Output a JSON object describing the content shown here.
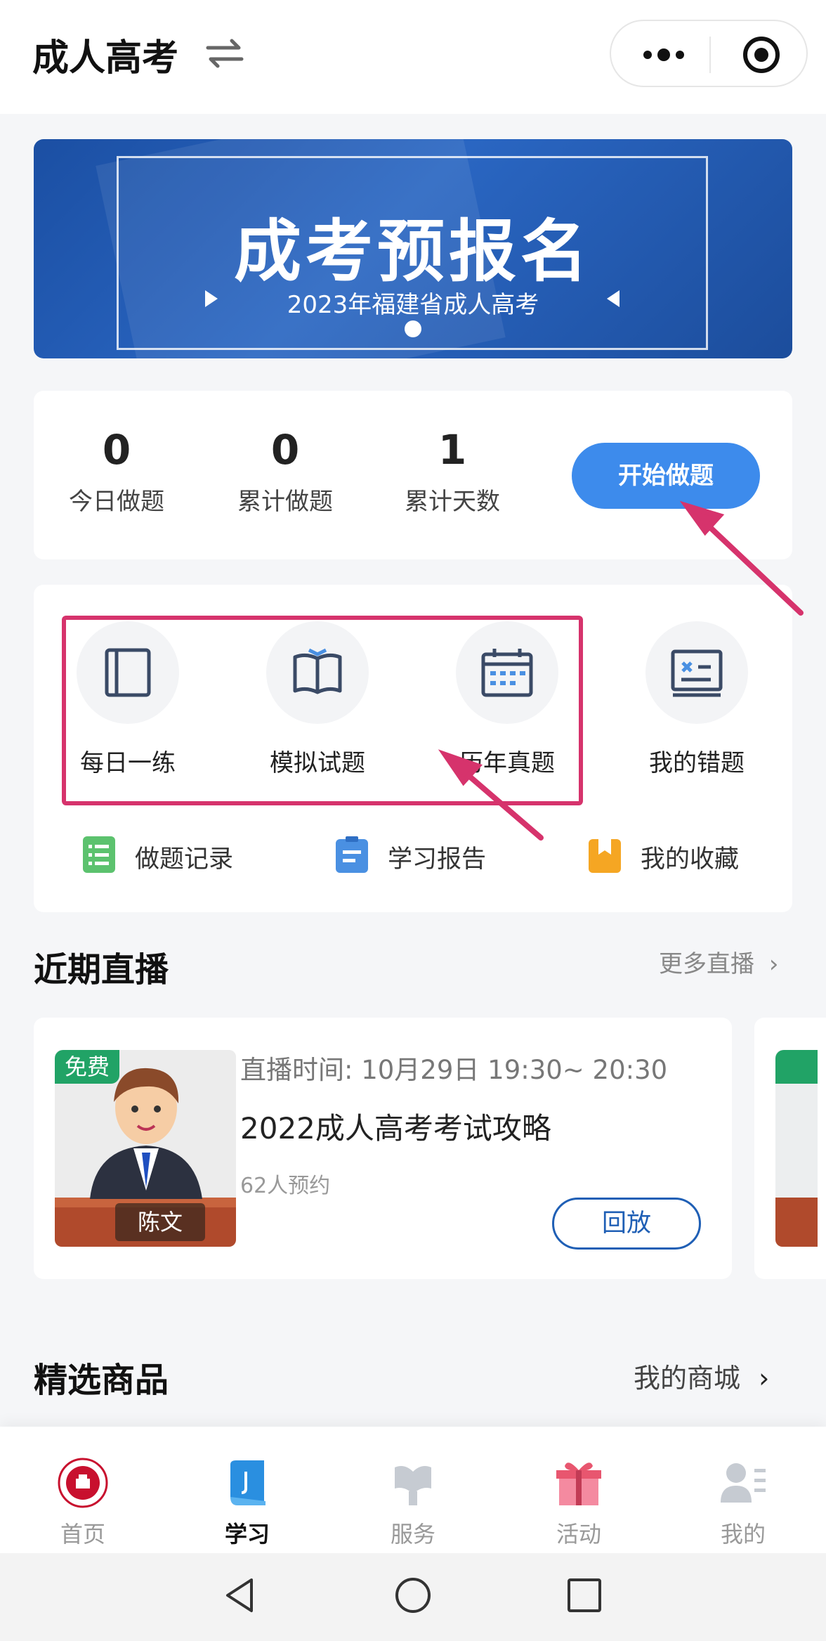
{
  "header": {
    "title": "成人高考"
  },
  "banner": {
    "title": "成考预报名",
    "subtitle": "2023年福建省成人高考"
  },
  "stats": {
    "items": [
      {
        "value": "0",
        "label": "今日做题"
      },
      {
        "value": "0",
        "label": "累计做题"
      },
      {
        "value": "1",
        "label": "累计天数"
      }
    ],
    "start_button": "开始做题"
  },
  "tools": {
    "items": [
      {
        "label": "每日一练",
        "icon": "notebook-icon"
      },
      {
        "label": "模拟试题",
        "icon": "open-book-icon"
      },
      {
        "label": "历年真题",
        "icon": "calendar-icon"
      },
      {
        "label": "我的错题",
        "icon": "wrong-answers-icon"
      }
    ],
    "links": [
      {
        "label": "做题记录",
        "icon": "record-list-icon",
        "color": "#5cc26e"
      },
      {
        "label": "学习报告",
        "icon": "clipboard-icon",
        "color": "#4a90e2"
      },
      {
        "label": "我的收藏",
        "icon": "bookmark-icon",
        "color": "#f5a623"
      }
    ]
  },
  "live": {
    "section_title": "近期直播",
    "more_label": "更多直播",
    "card": {
      "badge": "免费",
      "teacher": "陈文",
      "time": "直播时间:  10月29日 19:30~ 20:30",
      "title": "2022成人高考考试攻略",
      "reservations": "62人预约",
      "button": "回放"
    }
  },
  "products": {
    "section_title": "精选商品",
    "more_label": "我的商城"
  },
  "tabbar": {
    "items": [
      {
        "label": "首页",
        "icon": "school-logo-icon"
      },
      {
        "label": "学习",
        "icon": "study-book-icon",
        "active": true
      },
      {
        "label": "服务",
        "icon": "service-icon"
      },
      {
        "label": "活动",
        "icon": "gift-icon"
      },
      {
        "label": "我的",
        "icon": "profile-icon"
      }
    ]
  },
  "colors": {
    "accent": "#3d8bec",
    "highlight": "#d6336c",
    "badge": "#21a366"
  }
}
